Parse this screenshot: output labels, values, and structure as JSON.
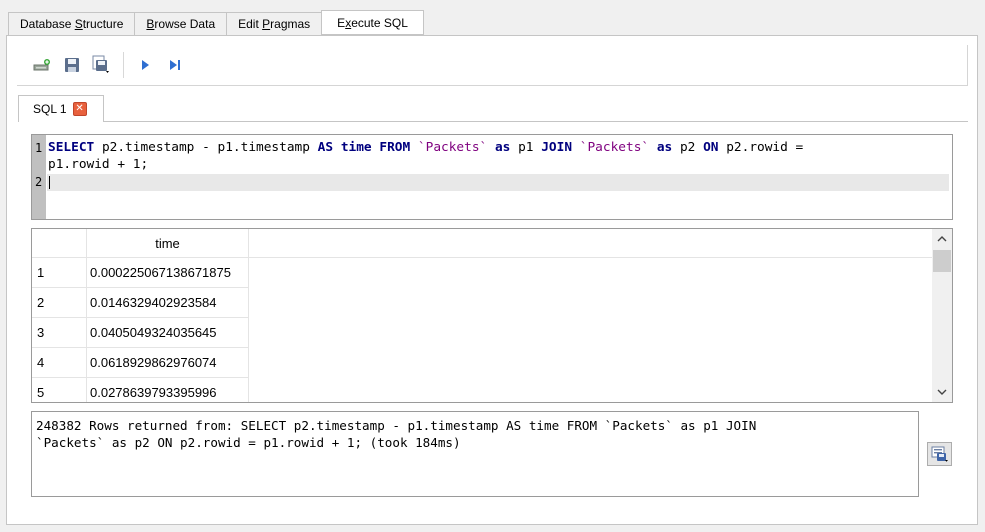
{
  "tabs": [
    {
      "prefix": "Database ",
      "ul": "S",
      "suffix": "tructure"
    },
    {
      "prefix": "",
      "ul": "B",
      "suffix": "rowse Data"
    },
    {
      "prefix": "Edit ",
      "ul": "P",
      "suffix": "ragmas"
    },
    {
      "prefix": "E",
      "ul": "x",
      "suffix": "ecute SQL"
    }
  ],
  "toolbar": {
    "icons": [
      "open-tab-icon",
      "save-icon",
      "save-as-icon",
      "execute-icon",
      "execute-line-icon"
    ]
  },
  "sql_tab": {
    "label": "SQL 1",
    "close": "✕"
  },
  "editor": {
    "line_numbers": [
      "1",
      "2"
    ],
    "line1a": [
      {
        "t": "SELECT",
        "c": "kw"
      },
      {
        "t": " p2.timestamp - p1.timestamp ",
        "c": ""
      },
      {
        "t": "AS",
        "c": "kw"
      },
      {
        "t": " ",
        "c": ""
      },
      {
        "t": "time",
        "c": "kw"
      },
      {
        "t": " ",
        "c": ""
      },
      {
        "t": "FROM",
        "c": "kw"
      },
      {
        "t": " ",
        "c": ""
      },
      {
        "t": "`Packets`",
        "c": "str"
      },
      {
        "t": " ",
        "c": ""
      },
      {
        "t": "as",
        "c": "kw"
      },
      {
        "t": " p1 ",
        "c": ""
      },
      {
        "t": "JOIN",
        "c": "kw"
      },
      {
        "t": " ",
        "c": ""
      },
      {
        "t": "`Packets`",
        "c": "str"
      },
      {
        "t": " ",
        "c": ""
      },
      {
        "t": "as",
        "c": "kw"
      },
      {
        "t": " p2 ",
        "c": ""
      },
      {
        "t": "ON",
        "c": "kw"
      },
      {
        "t": " p2.rowid =",
        "c": ""
      }
    ],
    "line1b": "p1.rowid + 1;"
  },
  "grid": {
    "column": "time",
    "rows": [
      {
        "n": "1",
        "v": "0.000225067138671875"
      },
      {
        "n": "2",
        "v": "0.0146329402923584"
      },
      {
        "n": "3",
        "v": "0.0405049324035645"
      },
      {
        "n": "4",
        "v": "0.0618929862976074"
      },
      {
        "n": "5",
        "v": "0.0278639793395996"
      }
    ]
  },
  "message": "248382 Rows returned from: SELECT p2.timestamp - p1.timestamp AS time FROM `Packets` as p1 JOIN\n`Packets` as p2 ON p2.rowid = p1.rowid + 1; (took 184ms)"
}
